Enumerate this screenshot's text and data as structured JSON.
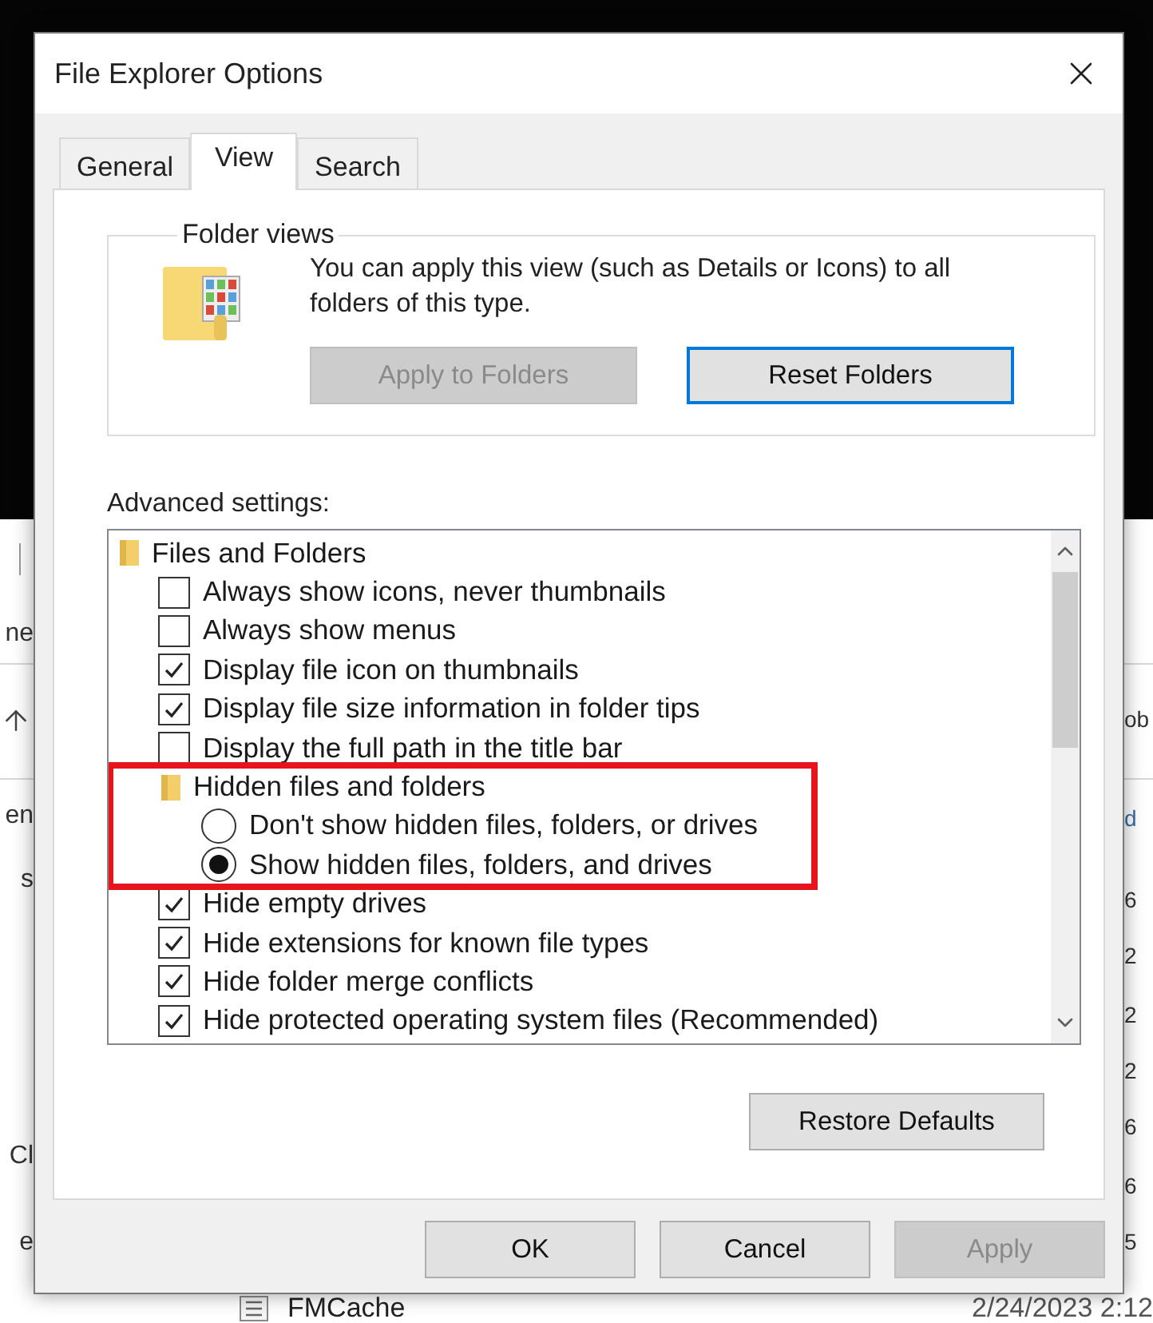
{
  "background_window": {
    "left_column": [
      {
        "kind": "text",
        "text": "ne"
      },
      {
        "kind": "up-arrow"
      },
      {
        "kind": "text",
        "text": "en"
      },
      {
        "kind": "text",
        "text": "s"
      },
      {
        "kind": "text",
        "text": "Cl"
      },
      {
        "kind": "text",
        "text": "e"
      }
    ],
    "right_column": [
      {
        "kind": "text",
        "text": "ob"
      },
      {
        "kind": "link",
        "text": "d"
      },
      {
        "kind": "text",
        "text": "6"
      },
      {
        "kind": "text",
        "text": "2"
      },
      {
        "kind": "text",
        "text": "2"
      },
      {
        "kind": "text",
        "text": "2"
      },
      {
        "kind": "text",
        "text": "6"
      },
      {
        "kind": "text",
        "text": "6"
      },
      {
        "kind": "text",
        "text": "5"
      }
    ],
    "last_row": {
      "name": "FMCache",
      "date": "2/24/2023 2:12"
    }
  },
  "dialog": {
    "title": "File Explorer Options",
    "tabs": [
      {
        "label": "General",
        "selected": false
      },
      {
        "label": "View",
        "selected": true
      },
      {
        "label": "Search",
        "selected": false
      }
    ],
    "folder_views": {
      "title": "Folder views",
      "description": "You can apply this view (such as Details or Icons) to all folders of this type.",
      "buttons": [
        {
          "label": "Apply to Folders",
          "disabled": true,
          "focused": false
        },
        {
          "label": "Reset Folders",
          "disabled": false,
          "focused": true
        }
      ]
    },
    "advanced_settings": {
      "label": "Advanced settings:",
      "items": [
        {
          "kind": "folder",
          "label": "Files and Folders",
          "highlighted": false,
          "children": [
            {
              "kind": "checkbox",
              "label": "Always show icons, never thumbnails",
              "checked": false
            },
            {
              "kind": "checkbox",
              "label": "Always show menus",
              "checked": false
            },
            {
              "kind": "checkbox",
              "label": "Display file icon on thumbnails",
              "checked": true
            },
            {
              "kind": "checkbox",
              "label": "Display file size information in folder tips",
              "checked": true
            },
            {
              "kind": "checkbox",
              "label": "Display the full path in the title bar",
              "checked": false
            },
            {
              "kind": "folder",
              "label": "Hidden files and folders",
              "highlighted": true,
              "children": [
                {
                  "kind": "radio",
                  "label": "Don't show hidden files, folders, or drives",
                  "selected": false
                },
                {
                  "kind": "radio",
                  "label": "Show hidden files, folders, and drives",
                  "selected": true
                }
              ]
            },
            {
              "kind": "checkbox",
              "label": "Hide empty drives",
              "checked": true
            },
            {
              "kind": "checkbox",
              "label": "Hide extensions for known file types",
              "checked": true
            },
            {
              "kind": "checkbox",
              "label": "Hide folder merge conflicts",
              "checked": true
            },
            {
              "kind": "checkbox",
              "label": "Hide protected operating system files (Recommended)",
              "checked": true
            }
          ]
        }
      ]
    },
    "restore_button": "Restore Defaults",
    "buttons": [
      {
        "label": "OK",
        "disabled": false
      },
      {
        "label": "Cancel",
        "disabled": false
      },
      {
        "label": "Apply",
        "disabled": true
      }
    ]
  }
}
